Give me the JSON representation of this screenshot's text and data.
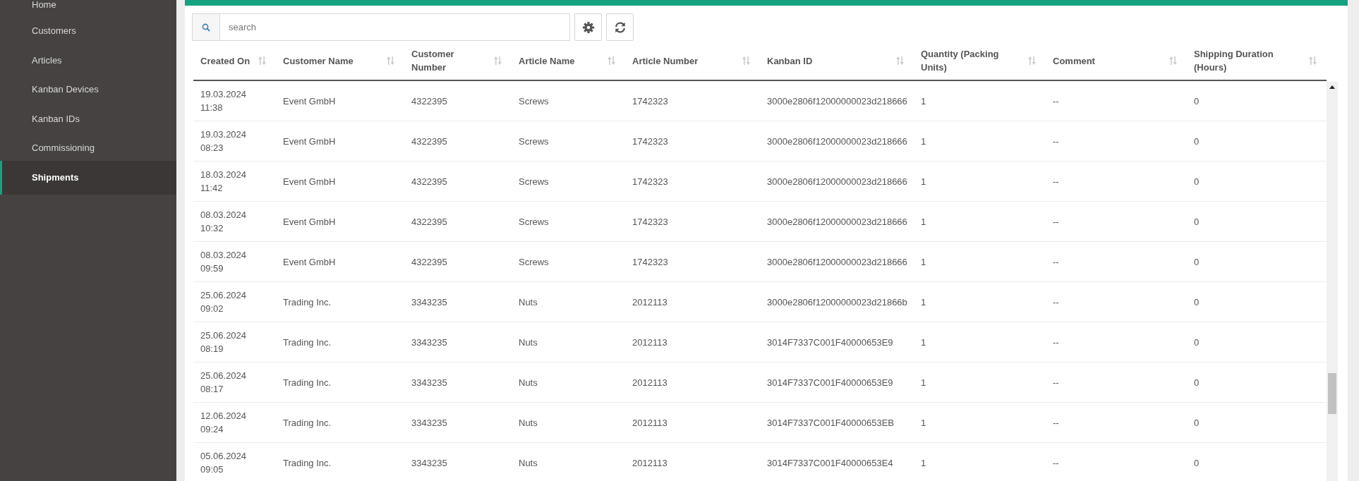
{
  "sidebar": {
    "items": [
      {
        "label": "Home",
        "selected": false
      },
      {
        "label": "Customers",
        "selected": false
      },
      {
        "label": "Articles",
        "selected": false
      },
      {
        "label": "Kanban Devices",
        "selected": false
      },
      {
        "label": "Kanban IDs",
        "selected": false
      },
      {
        "label": "Commissioning",
        "selected": false
      },
      {
        "label": "Shipments",
        "selected": true
      }
    ]
  },
  "search": {
    "placeholder": "search"
  },
  "table": {
    "columns": [
      "Created On",
      "Customer Name",
      "Customer Number",
      "Article Name",
      "Article Number",
      "Kanban ID",
      "Quantity (Packing Units)",
      "Comment",
      "Shipping Duration (Hours)"
    ],
    "rows": [
      [
        "19.03.2024 11:38",
        "Event GmbH",
        "4322395",
        "Screws",
        "1742323",
        "3000e2806f12000000023d218666",
        "1",
        "--",
        "0"
      ],
      [
        "19.03.2024 08:23",
        "Event GmbH",
        "4322395",
        "Screws",
        "1742323",
        "3000e2806f12000000023d218666",
        "1",
        "--",
        "0"
      ],
      [
        "18.03.2024 11:42",
        "Event GmbH",
        "4322395",
        "Screws",
        "1742323",
        "3000e2806f12000000023d218666",
        "1",
        "--",
        "0"
      ],
      [
        "08.03.2024 10:32",
        "Event GmbH",
        "4322395",
        "Screws",
        "1742323",
        "3000e2806f12000000023d218666",
        "1",
        "--",
        "0"
      ],
      [
        "08.03.2024 09:59",
        "Event GmbH",
        "4322395",
        "Screws",
        "1742323",
        "3000e2806f12000000023d218666",
        "1",
        "--",
        "0"
      ],
      [
        "25.06.2024 09:02",
        "Trading Inc.",
        "3343235",
        "Nuts",
        "2012113",
        "3000e2806f12000000023d21866b",
        "1",
        "--",
        "0"
      ],
      [
        "25.06.2024 08:19",
        "Trading Inc.",
        "3343235",
        "Nuts",
        "2012113",
        "3014F7337C001F40000653E9",
        "1",
        "--",
        "0"
      ],
      [
        "25.06.2024 08:17",
        "Trading Inc.",
        "3343235",
        "Nuts",
        "2012113",
        "3014F7337C001F40000653E9",
        "1",
        "--",
        "0"
      ],
      [
        "12.06.2024 09:24",
        "Trading Inc.",
        "3343235",
        "Nuts",
        "2012113",
        "3014F7337C001F40000653EB",
        "1",
        "--",
        "0"
      ],
      [
        "05.06.2024 09:05",
        "Trading Inc.",
        "3343235",
        "Nuts",
        "2012113",
        "3014F7337C001F40000653E4",
        "1",
        "--",
        "0"
      ]
    ]
  }
}
